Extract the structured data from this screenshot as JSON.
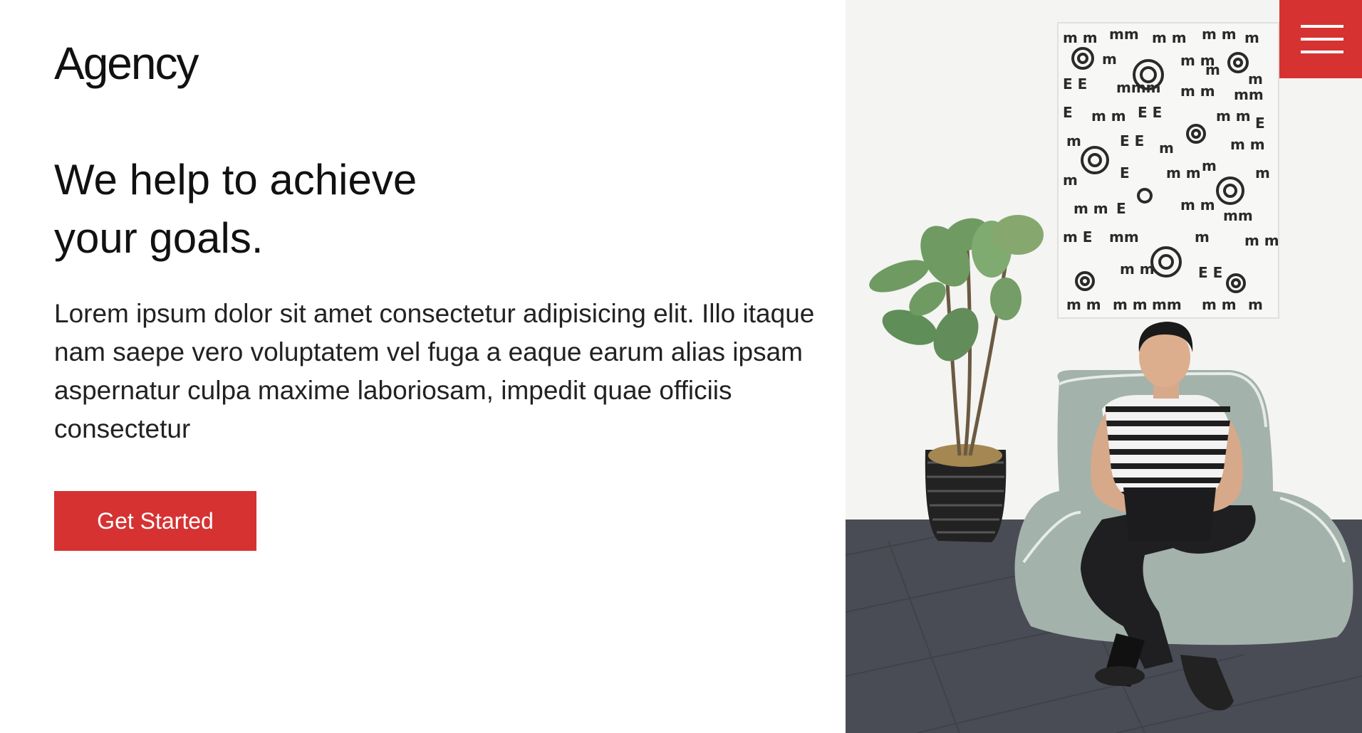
{
  "brand": {
    "logo_text": "Agency"
  },
  "hero": {
    "headline_line1": "We help to achieve",
    "headline_line2": "your goals.",
    "description": "Lorem ipsum dolor sit amet consectetur adipisicing elit. Illo itaque nam saepe vero voluptatem vel fuga a eaque earum alias ipsam aspernatur culpa maxime laboriosam, impedit quae officiis consectetur",
    "cta_label": "Get Started"
  },
  "menu": {
    "icon": "hamburger-menu-icon"
  },
  "image": {
    "subject": "hero-photo"
  },
  "colors": {
    "accent": "#d63232",
    "text": "#111111",
    "background": "#ffffff"
  }
}
